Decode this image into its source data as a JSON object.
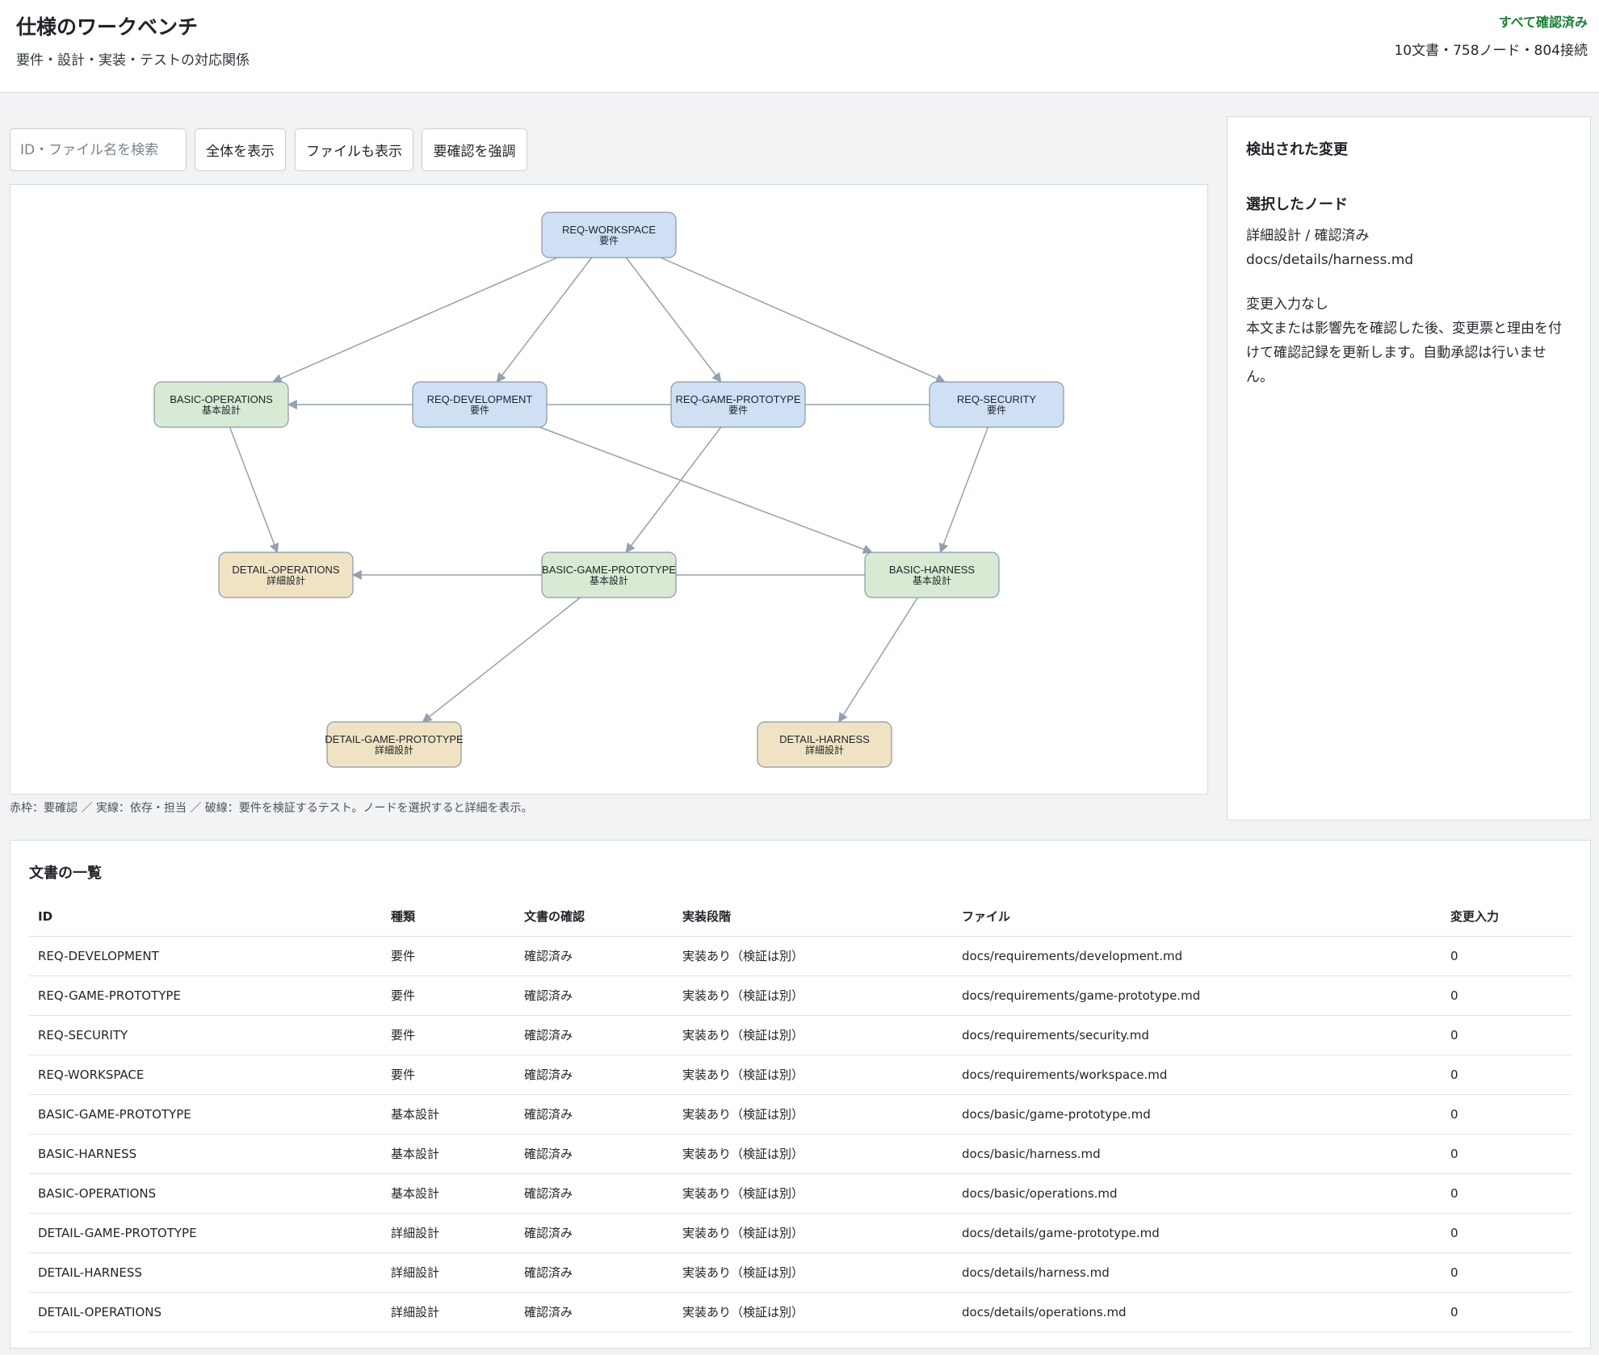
{
  "header": {
    "title": "仕様のワークベンチ",
    "subtitle": "要件・設計・実装・テストの対応関係",
    "status": "すべて確認済み",
    "stats": "10文書・758ノード・804接続"
  },
  "toolbar": {
    "search_placeholder": "ID・ファイル名を検索",
    "show_all": "全体を表示",
    "show_files": "ファイルも表示",
    "highlight_review": "要確認を強調"
  },
  "colors": {
    "requirement": "#cfe0f5",
    "basic": "#d8ead3",
    "detail": "#efe3c4",
    "status_ok": "#1a7f37"
  },
  "graph": {
    "nodes": [
      {
        "id": "REQ-WORKSPACE",
        "kind": "要件"
      },
      {
        "id": "BASIC-OPERATIONS",
        "kind": "基本設計"
      },
      {
        "id": "REQ-DEVELOPMENT",
        "kind": "要件"
      },
      {
        "id": "REQ-GAME-PROTOTYPE",
        "kind": "要件"
      },
      {
        "id": "REQ-SECURITY",
        "kind": "要件"
      },
      {
        "id": "DETAIL-OPERATIONS",
        "kind": "詳細設計"
      },
      {
        "id": "BASIC-GAME-PROTOTYPE",
        "kind": "基本設計"
      },
      {
        "id": "BASIC-HARNESS",
        "kind": "基本設計"
      },
      {
        "id": "DETAIL-GAME-PROTOTYPE",
        "kind": "詳細設計"
      },
      {
        "id": "DETAIL-HARNESS",
        "kind": "詳細設計"
      }
    ],
    "edges": [
      {
        "from": "REQ-WORKSPACE",
        "to": "BASIC-OPERATIONS"
      },
      {
        "from": "REQ-WORKSPACE",
        "to": "REQ-DEVELOPMENT"
      },
      {
        "from": "REQ-WORKSPACE",
        "to": "REQ-GAME-PROTOTYPE"
      },
      {
        "from": "REQ-WORKSPACE",
        "to": "REQ-SECURITY"
      },
      {
        "from": "REQ-DEVELOPMENT",
        "to": "BASIC-OPERATIONS"
      },
      {
        "from": "REQ-DEVELOPMENT",
        "to": "BASIC-HARNESS"
      },
      {
        "from": "REQ-GAME-PROTOTYPE",
        "to": "BASIC-GAME-PROTOTYPE"
      },
      {
        "from": "REQ-SECURITY",
        "to": "BASIC-HARNESS"
      },
      {
        "from": "BASIC-OPERATIONS",
        "to": "DETAIL-OPERATIONS"
      },
      {
        "from": "BASIC-GAME-PROTOTYPE",
        "to": "DETAIL-OPERATIONS"
      },
      {
        "from": "BASIC-GAME-PROTOTYPE",
        "to": "DETAIL-GAME-PROTOTYPE"
      },
      {
        "from": "BASIC-HARNESS",
        "to": "DETAIL-HARNESS"
      },
      {
        "from": "REQ-GAME-PROTOTYPE",
        "to": "REQ-SECURITY",
        "plain": true
      },
      {
        "from": "REQ-DEVELOPMENT",
        "to": "REQ-GAME-PROTOTYPE",
        "plain": true
      },
      {
        "from": "BASIC-GAME-PROTOTYPE",
        "to": "BASIC-HARNESS",
        "plain": true
      }
    ],
    "legend": "赤枠：要確認 ／ 実線：依存・担当 ／ 破線：要件を検証するテスト。ノードを選択すると詳細を表示。"
  },
  "side": {
    "changes_heading": "検出された変更",
    "selected_heading": "選択したノード",
    "selected_meta": "詳細設計 / 確認済み",
    "selected_file": "docs/details/harness.md",
    "change_input_label": "変更入力なし",
    "change_input_desc": "本文または影響先を確認した後、変更票と理由を付けて確認記録を更新します。自動承認は行いません。"
  },
  "docs": {
    "title": "文書の一覧",
    "headers": [
      "ID",
      "種類",
      "文書の確認",
      "実装段階",
      "ファイル",
      "変更入力"
    ],
    "rows": [
      [
        "REQ-DEVELOPMENT",
        "要件",
        "確認済み",
        "実装あり（検証は別）",
        "docs/requirements/development.md",
        "0"
      ],
      [
        "REQ-GAME-PROTOTYPE",
        "要件",
        "確認済み",
        "実装あり（検証は別）",
        "docs/requirements/game-prototype.md",
        "0"
      ],
      [
        "REQ-SECURITY",
        "要件",
        "確認済み",
        "実装あり（検証は別）",
        "docs/requirements/security.md",
        "0"
      ],
      [
        "REQ-WORKSPACE",
        "要件",
        "確認済み",
        "実装あり（検証は別）",
        "docs/requirements/workspace.md",
        "0"
      ],
      [
        "BASIC-GAME-PROTOTYPE",
        "基本設計",
        "確認済み",
        "実装あり（検証は別）",
        "docs/basic/game-prototype.md",
        "0"
      ],
      [
        "BASIC-HARNESS",
        "基本設計",
        "確認済み",
        "実装あり（検証は別）",
        "docs/basic/harness.md",
        "0"
      ],
      [
        "BASIC-OPERATIONS",
        "基本設計",
        "確認済み",
        "実装あり（検証は別）",
        "docs/basic/operations.md",
        "0"
      ],
      [
        "DETAIL-GAME-PROTOTYPE",
        "詳細設計",
        "確認済み",
        "実装あり（検証は別）",
        "docs/details/game-prototype.md",
        "0"
      ],
      [
        "DETAIL-HARNESS",
        "詳細設計",
        "確認済み",
        "実装あり（検証は別）",
        "docs/details/harness.md",
        "0"
      ],
      [
        "DETAIL-OPERATIONS",
        "詳細設計",
        "確認済み",
        "実装あり（検証は別）",
        "docs/details/operations.md",
        "0"
      ]
    ]
  }
}
